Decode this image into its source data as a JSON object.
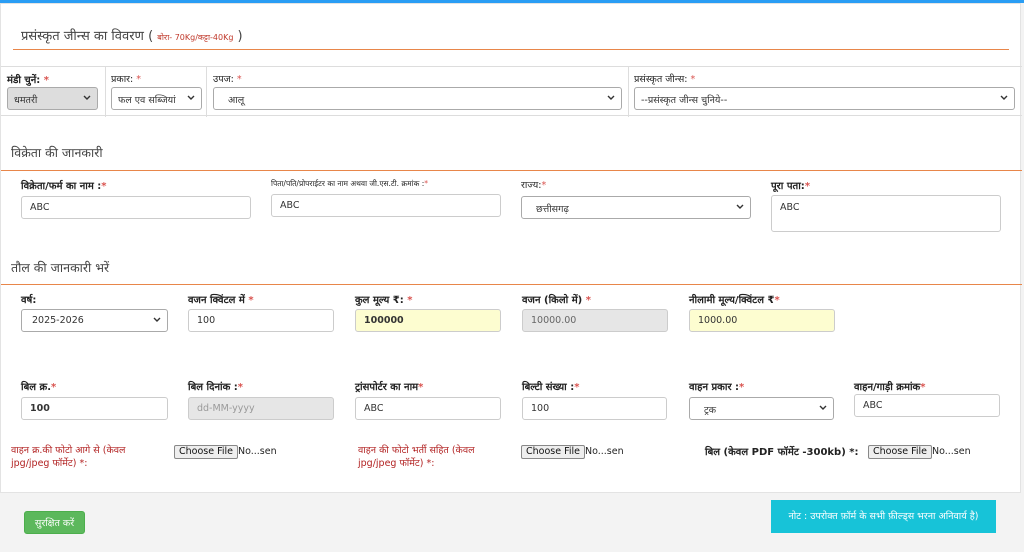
{
  "header": {
    "title": "प्रसंस्कृत जीन्स का विवरण",
    "subtitle_open": "( ",
    "subtitle": "बोरा- 70Kg/कट्टा-40Kg",
    "subtitle_close": " )"
  },
  "row1": {
    "mandi_label": "मंडी चुनें:",
    "mandi_value": "धमतरी",
    "prakar_label": "प्रकार:",
    "prakar_value": "फल एव सब्जियां",
    "upaj_label": "उपज:",
    "upaj_value": "आलू",
    "jeans_label": "प्रसंस्कृत जीन्स:",
    "jeans_value": "--प्रसंस्कृत जीन्स चुनिये--",
    "required_mark": "*"
  },
  "seller": {
    "section_title": "विक्रेता की जानकारी",
    "firm_label": "विक्रेता/फर्म का नाम :",
    "firm_value": "ABC",
    "proprietor_label": "पिता/पति/प्रोपराईटर का नाम अथवा जी.एस.टी. क्रमांक :",
    "proprietor_value": "ABC",
    "state_label": "राज्य:",
    "state_value": "छत्तीसगढ़",
    "address_label": "पूरा पता:",
    "address_value": "ABC"
  },
  "weighing": {
    "section_title": "तौल की जानकारी भरें",
    "year_label": "वर्ष:",
    "year_value": "2025-2026",
    "quintal_label": "वजन क्विंटल में",
    "quintal_value": "100",
    "total_label": "कुल मूल्य ₹:",
    "total_value": "100000",
    "kg_label": "वजन (किलो में)",
    "kg_value": "10000.00",
    "auction_label": "नीलामी मूल्य/क्विंटल ₹",
    "auction_value": "1000.00",
    "bill_no_label": "बिल क्र.",
    "bill_no_value": "100",
    "bill_date_label": "बिल दिनांक :",
    "bill_date_placeholder": "dd-MM-yyyy",
    "transporter_label": "ट्रांसपोर्टर का नाम",
    "transporter_value": "ABC",
    "bilti_label": "बिल्टी संख्या :",
    "bilti_value": "100",
    "vehicle_type_label": "वाहन प्रकार :",
    "vehicle_type_value": "ट्रक",
    "vehicle_no_label": "वाहन/गाड़ी क्रमांक",
    "vehicle_no_value": "ABC"
  },
  "uploads": {
    "front_photo_label": "वाहन क्र.की फोटो आगे से (केवल jpg/jpeg फॉर्मेट) *:",
    "loaded_photo_label": "वाहन की फोटो भर्ती सहित (केवल jpg/jpeg फॉर्मेट) *:",
    "bill_pdf_label": "बिल (केवल PDF फॉर्मेट -300kb) *:",
    "choose_file": "Choose File",
    "no_file": "No...sen"
  },
  "footer": {
    "save_label": "सुरक्षित करें",
    "note": "नोट : उपरोक्त फ़ॉर्म के सभी फ़ील्ड्स भरना अनिवार्य है)"
  },
  "colors": {
    "top_bar": "#2a9df4",
    "accent_line": "#e8864a",
    "required": "#d9534f",
    "save_button": "#5cb85c",
    "note_bg": "#17c3d8",
    "highlight_input": "#fdfdd0"
  }
}
